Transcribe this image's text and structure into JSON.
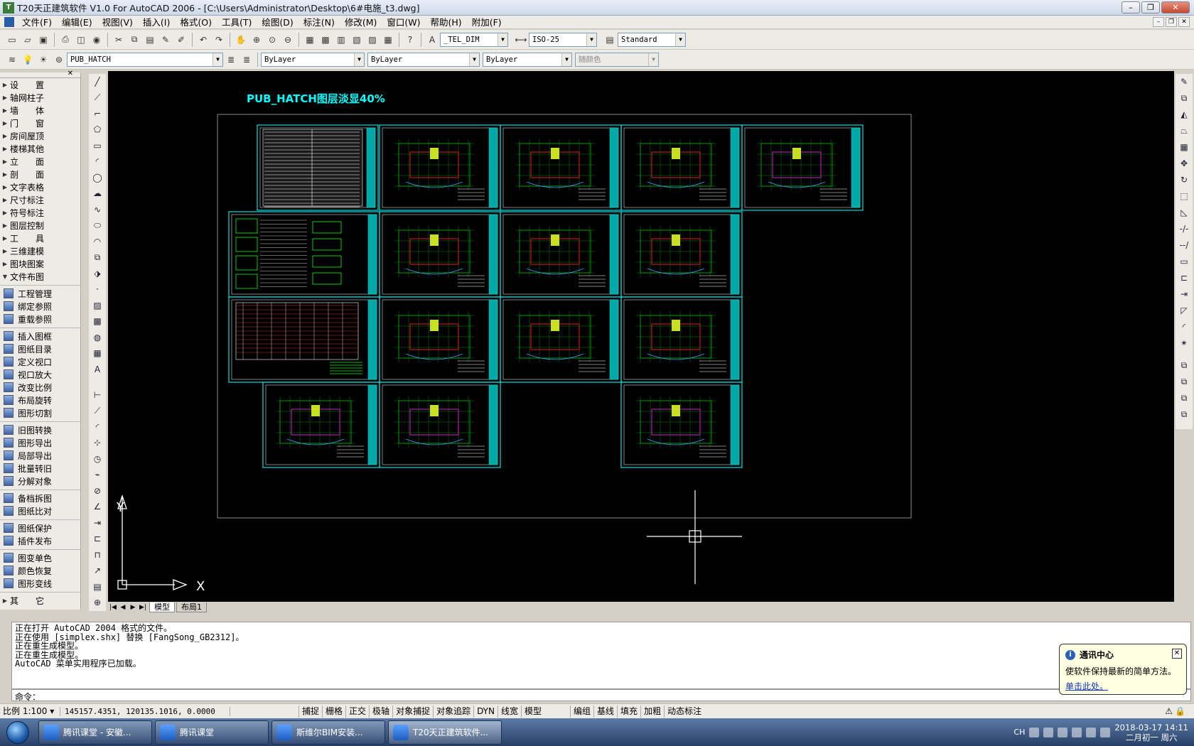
{
  "window": {
    "title": "T20天正建筑软件 V1.0 For AutoCAD 2006 - [C:\\Users\\Administrator\\Desktop\\6#电施_t3.dwg]",
    "controls": [
      "–",
      "❐",
      "✕"
    ]
  },
  "menubar": [
    "文件(F)",
    "编辑(E)",
    "视图(V)",
    "插入(I)",
    "格式(O)",
    "工具(T)",
    "绘图(D)",
    "标注(N)",
    "修改(M)",
    "窗口(W)",
    "帮助(H)",
    "附加(F)"
  ],
  "toolbar1": {
    "text_style": "_TEL_DIM",
    "dim_style": "ISO-25",
    "table_style": "Standard"
  },
  "toolbar2": {
    "layer": "PUB_HATCH",
    "color": "ByLayer",
    "linetype": "ByLayer",
    "lineweight": "ByLayer",
    "plotstyle": "随颜色"
  },
  "sidebar": {
    "menu": [
      "设　　置",
      "轴网柱子",
      "墙　　体",
      "门　　窗",
      "房间屋顶",
      "楼梯其他",
      "立　　面",
      "剖　　面",
      "文字表格",
      "尺寸标注",
      "符号标注",
      "图层控制",
      "工　　具",
      "三维建模",
      "图块图案",
      "文件布图"
    ],
    "expanded_index": 15,
    "submenu_groups": [
      [
        "工程管理",
        "绑定参照",
        "重载参照"
      ],
      [
        "插入图框",
        "图纸目录",
        "定义视口",
        "视口放大",
        "改变比例",
        "布局旋转",
        "图形切割"
      ],
      [
        "旧图转换",
        "图形导出",
        "局部导出",
        "批量转旧",
        "分解对象"
      ],
      [
        "备档拆图",
        "图纸比对"
      ],
      [
        "图纸保护",
        "插件发布"
      ],
      [
        "图变单色",
        "颜色恢复",
        "图形变线"
      ]
    ],
    "last": "其　　它"
  },
  "drawing": {
    "banner": "PUB_HATCH图层淡显40%",
    "ucs_y": "Y",
    "ucs_x": "X"
  },
  "tabs": {
    "model": "模型",
    "layout": "布局1"
  },
  "command_history": [
    "正在打开 AutoCAD 2004 格式的文件。",
    "正在使用 [simplex.shx] 替换 [FangSong_GB2312]。",
    "正在重生成模型。",
    "正在重生成模型。",
    "AutoCAD 菜单实用程序已加载。"
  ],
  "command_prompt": "命令：",
  "statusbar": {
    "scale": "比例 1:100 ▾",
    "coords": "145157.4351, 120135.1016, 0.0000",
    "toggles": [
      "捕捉",
      "栅格",
      "正交",
      "极轴",
      "对象捕捉",
      "对象追踪",
      "DYN",
      "线宽",
      "模型"
    ],
    "tangent_toggles": [
      "编组",
      "基线",
      "填充",
      "加粗",
      "动态标注"
    ]
  },
  "balloon": {
    "title": "通讯中心",
    "body": "使软件保持最新的简单方法。",
    "link": "单击此处。"
  },
  "taskbar": {
    "tasks": [
      "腾讯课堂 - 安徽...",
      "腾讯课堂",
      "斯维尔BIM安装...",
      "T20天正建筑软件..."
    ],
    "active_index": 3,
    "lang": "CH",
    "time": "2018-03-17 14:11",
    "date": "二月初一 周六"
  },
  "colors": {
    "canvas": "#000000",
    "frame": "#00e0e0",
    "accent_cyan": "#00ffff"
  }
}
